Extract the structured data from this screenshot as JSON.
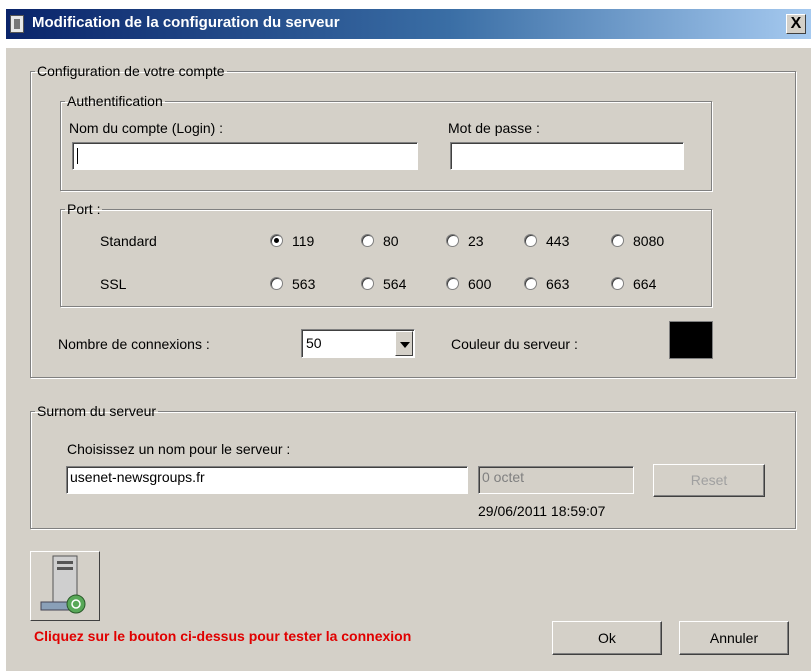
{
  "window": {
    "title": "Modification de la configuration du serveur",
    "close_label": "X"
  },
  "account": {
    "legend": "Configuration de votre compte",
    "auth": {
      "legend": "Authentification",
      "login_label": "Nom du compte (Login) :",
      "login_value": "",
      "password_label": "Mot de passe :",
      "password_value": ""
    },
    "port": {
      "legend": "Port :",
      "standard_label": "Standard",
      "ssl_label": "SSL",
      "standard_options": [
        "119",
        "80",
        "23",
        "443",
        "8080"
      ],
      "ssl_options": [
        "563",
        "564",
        "600",
        "663",
        "664"
      ],
      "selected": "119"
    },
    "connections_label": "Nombre de connexions :",
    "connections_value": "50",
    "color_label": "Couleur du serveur :",
    "color_value": "#000000"
  },
  "nickname": {
    "legend": "Surnom du serveur",
    "prompt": "Choisissez un nom pour le serveur :",
    "name_value": "usenet-newsgroups.fr",
    "size_value": "0 octet",
    "reset_label": "Reset",
    "timestamp": "29/06/2011 18:59:07"
  },
  "footer": {
    "test_hint": "Cliquez sur le bouton ci-dessus pour tester la connexion",
    "ok_label": "Ok",
    "cancel_label": "Annuler",
    "hint_color": "#e00000"
  }
}
